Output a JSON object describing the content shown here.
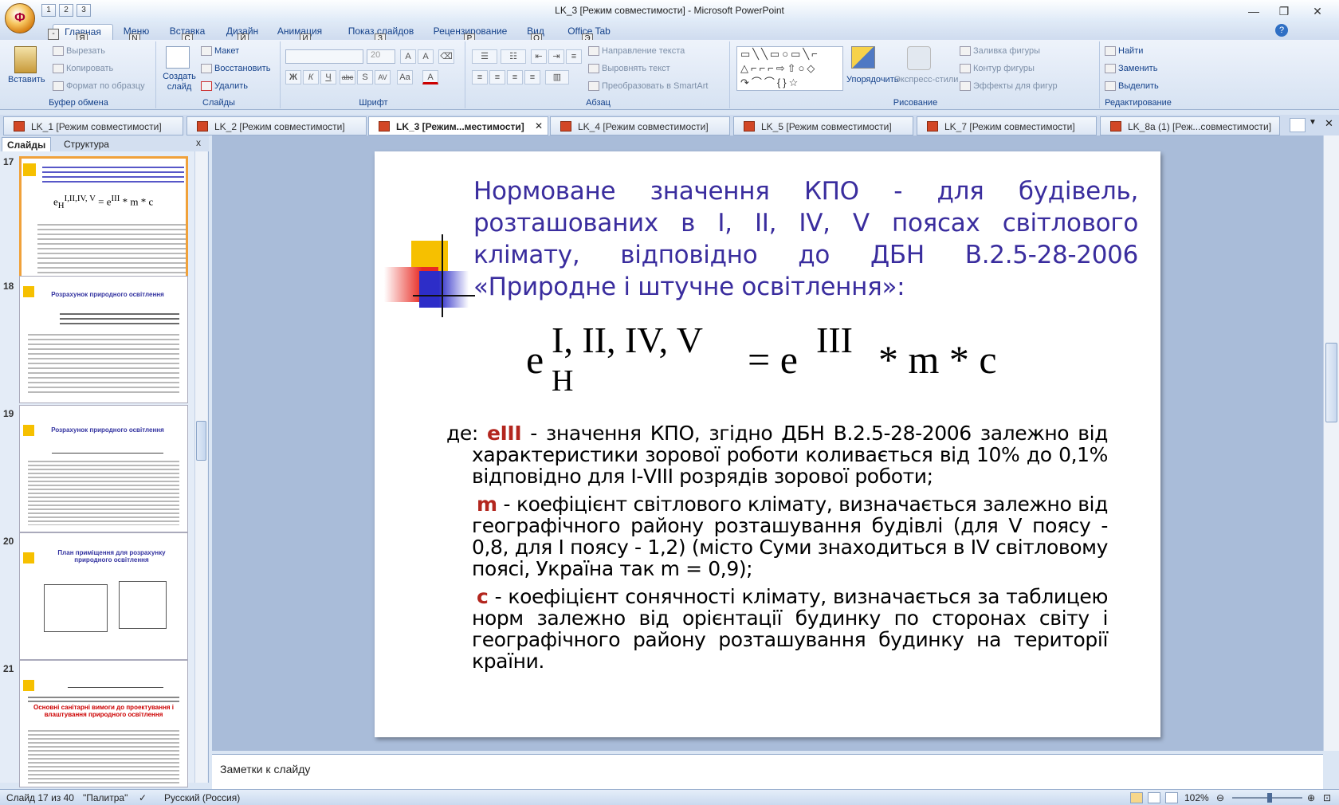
{
  "window": {
    "title": "LK_3 [Режим совместимости] - Microsoft PowerPoint",
    "office_button": "Ф",
    "minimize": "—",
    "restore": "❐",
    "close": "✕"
  },
  "qat": [
    "1",
    "2",
    "3"
  ],
  "ribbon_tabs": [
    {
      "label": "Главная",
      "key": "Я"
    },
    {
      "label": "Меню",
      "key": "N"
    },
    {
      "label": "Вставка",
      "key": "С"
    },
    {
      "label": "Дизайн",
      "key": "Й"
    },
    {
      "label": "Анимация",
      "key": "И"
    },
    {
      "label": "Показ слайдов",
      "key": "З"
    },
    {
      "label": "Рецензирование",
      "key": "Р"
    },
    {
      "label": "Вид",
      "key": "О"
    },
    {
      "label": "Office Tab",
      "key": "Э"
    }
  ],
  "ribbon": {
    "clipboard": {
      "label": "Буфер обмена",
      "paste": "Вставить",
      "cut": "Вырезать",
      "copy": "Копировать",
      "format": "Формат по образцу"
    },
    "slides": {
      "label": "Слайды",
      "create": "Создать слайд",
      "layout": "Макет",
      "reset": "Восстановить",
      "delete": "Удалить"
    },
    "font": {
      "label": "Шрифт",
      "size": "20",
      "bold": "Ж",
      "italic": "К",
      "underline": "Ч",
      "strike": "abc",
      "shadow": "S",
      "spacing": "AV",
      "case": "Aa",
      "color": "A"
    },
    "paragraph": {
      "label": "Абзац",
      "direction": "Направление текста",
      "align": "Выровнять текст",
      "smartart": "Преобразовать в SmartArt"
    },
    "drawing": {
      "label": "Рисование",
      "arrange": "Упорядочить",
      "quick_styles": "Экспресс-стили",
      "fill": "Заливка фигуры",
      "outline": "Контур фигуры",
      "effects": "Эффекты для фигур"
    },
    "editing": {
      "label": "Редактирование",
      "find": "Найти",
      "replace": "Заменить",
      "select": "Выделить"
    }
  },
  "doc_tabs": [
    "LK_1 [Режим совместимости]",
    "LK_2 [Режим совместимости]",
    "LK_3 [Режим...местимости]",
    "LK_4 [Режим совместимости]",
    "LK_5 [Режим совместимости]",
    "LK_7 [Режим совместимости]",
    "LK_8a (1) [Реж...совместимости]"
  ],
  "left_pane": {
    "tabs": [
      "Слайды",
      "Структура"
    ],
    "close": "x",
    "thumbnails": [
      {
        "num": "17",
        "title": ""
      },
      {
        "num": "18",
        "title": "Розрахунок природного освітлення"
      },
      {
        "num": "19",
        "title": "Розрахунок природного освітлення"
      },
      {
        "num": "20",
        "title": "План приміщення для розрахунку природного освітлення"
      },
      {
        "num": "21",
        "title": "Основні санітарні вимоги до проектування і влаштування природного освітлення"
      }
    ]
  },
  "slide": {
    "title": "Нормоване значення КПО - для будівель, розташованих в І, ІІ, ІV, V поясах світлового клімату, відповідно до ДБН В.2.5-28-2006 «Природне і штучне освітлення»:",
    "formula": {
      "e": "e",
      "sub": "Н",
      "sup": "I, II, IV, V",
      "eq": "= e",
      "sup2": "III",
      "rest": "* m * c"
    },
    "p1_prefix": "де: ",
    "p1_kw": "eIII",
    "p1_text": " - значення КПО, згідно ДБН В.2.5-28-2006 залежно від характеристики зорової роботи коливається від 10% до 0,1% відповідно для І-VIII розрядів зорової роботи;",
    "p2_kw": "m",
    "p2_text": " - коефіцієнт світлового клімату, визначається залежно від географічного району розташування будівлі (для V поясу - 0,8, для І поясу - 1,2) (місто Суми знаходиться в IV світловому поясі, Україна так m = 0,9);",
    "p3_kw": "с",
    "p3_text": " - коефіцієнт сонячності клімату, визначається за таблицею норм залежно від орієнтації будинку по сторонах світу і географічного району розташування будинку на території країни."
  },
  "notes": {
    "placeholder": "Заметки к слайду"
  },
  "status": {
    "slide": "Слайд 17 из 40",
    "theme": "\"Палитра\"",
    "lang": "Русский (Россия)",
    "zoom": "102%"
  },
  "colors": {
    "title": "#3a2d9e",
    "keyword": "#b3261e",
    "accent_yellow": "#f6c000",
    "accent_red": "#e0201c",
    "accent_blue": "#2d2dc8"
  }
}
